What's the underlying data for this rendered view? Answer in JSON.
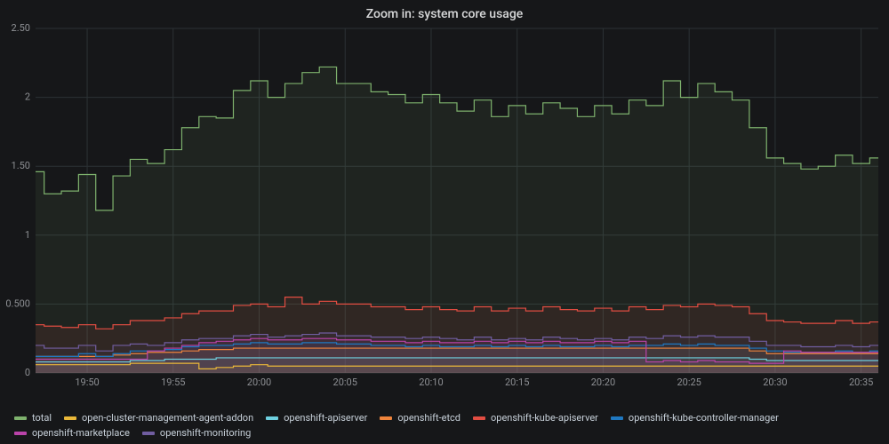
{
  "title": "Zoom in: system core usage",
  "chart_data": {
    "type": "area",
    "xlabel": "",
    "ylabel": "",
    "ylim": [
      0,
      2.5
    ],
    "y_ticks": [
      0,
      0.5,
      1,
      1.5,
      2,
      2.5
    ],
    "y_tick_labels": [
      "0",
      "0.500",
      "1",
      "1.50",
      "2",
      "2.50"
    ],
    "x_tick_labels": [
      "19:50",
      "19:55",
      "20:00",
      "20:05",
      "20:10",
      "20:15",
      "20:20",
      "20:25",
      "20:30",
      "20:35"
    ],
    "x_tick_index": [
      3,
      8,
      13,
      18,
      23,
      28,
      33,
      38,
      43,
      48
    ],
    "x": [
      0,
      1,
      2,
      3,
      4,
      5,
      6,
      7,
      8,
      9,
      10,
      11,
      12,
      13,
      14,
      15,
      16,
      17,
      18,
      19,
      20,
      21,
      22,
      23,
      24,
      25,
      26,
      27,
      28,
      29,
      30,
      31,
      32,
      33,
      34,
      35,
      36,
      37,
      38,
      39,
      40,
      41,
      42,
      43,
      44,
      45,
      46,
      47,
      48,
      49
    ],
    "series": [
      {
        "name": "total",
        "color": "#7eb26d",
        "values": [
          1.46,
          1.3,
          1.32,
          1.44,
          1.18,
          1.43,
          1.55,
          1.52,
          1.62,
          1.78,
          1.86,
          1.85,
          2.05,
          2.12,
          2.0,
          2.1,
          2.18,
          2.22,
          2.1,
          2.1,
          2.04,
          2.02,
          1.96,
          2.02,
          1.96,
          1.9,
          1.98,
          1.86,
          1.94,
          1.88,
          1.96,
          1.92,
          1.86,
          1.94,
          1.88,
          1.98,
          1.94,
          2.12,
          2.0,
          2.1,
          2.04,
          1.98,
          1.78,
          1.56,
          1.52,
          1.48,
          1.5,
          1.58,
          1.52,
          1.56
        ]
      },
      {
        "name": "open-cluster-management-agent-addon",
        "color": "#eab839",
        "values": [
          0.06,
          0.06,
          0.06,
          0.06,
          0.06,
          0.06,
          0.07,
          0.07,
          0.07,
          0.07,
          0.03,
          0.04,
          0.05,
          0.06,
          0.05,
          0.05,
          0.05,
          0.05,
          0.05,
          0.05,
          0.05,
          0.05,
          0.05,
          0.05,
          0.05,
          0.05,
          0.05,
          0.05,
          0.05,
          0.05,
          0.05,
          0.05,
          0.05,
          0.05,
          0.05,
          0.05,
          0.05,
          0.05,
          0.05,
          0.05,
          0.05,
          0.05,
          0.05,
          0.05,
          0.05,
          0.05,
          0.05,
          0.05,
          0.05,
          0.05
        ]
      },
      {
        "name": "openshift-apiserver",
        "color": "#6ed0e0",
        "values": [
          0.08,
          0.08,
          0.08,
          0.08,
          0.08,
          0.08,
          0.09,
          0.09,
          0.1,
          0.1,
          0.1,
          0.11,
          0.11,
          0.11,
          0.11,
          0.11,
          0.11,
          0.11,
          0.11,
          0.11,
          0.11,
          0.11,
          0.11,
          0.11,
          0.11,
          0.11,
          0.11,
          0.11,
          0.11,
          0.11,
          0.11,
          0.11,
          0.11,
          0.11,
          0.11,
          0.11,
          0.11,
          0.11,
          0.11,
          0.11,
          0.11,
          0.11,
          0.1,
          0.09,
          0.09,
          0.09,
          0.09,
          0.09,
          0.09,
          0.09
        ]
      },
      {
        "name": "openshift-etcd",
        "color": "#ef843c",
        "values": [
          0.12,
          0.12,
          0.12,
          0.12,
          0.12,
          0.13,
          0.14,
          0.15,
          0.15,
          0.16,
          0.17,
          0.17,
          0.18,
          0.18,
          0.18,
          0.18,
          0.18,
          0.18,
          0.18,
          0.18,
          0.18,
          0.18,
          0.18,
          0.18,
          0.18,
          0.18,
          0.18,
          0.18,
          0.18,
          0.18,
          0.18,
          0.18,
          0.18,
          0.18,
          0.18,
          0.18,
          0.18,
          0.18,
          0.18,
          0.18,
          0.18,
          0.18,
          0.16,
          0.14,
          0.14,
          0.14,
          0.14,
          0.14,
          0.14,
          0.14
        ]
      },
      {
        "name": "openshift-kube-apiserver",
        "color": "#e24d42",
        "values": [
          0.35,
          0.34,
          0.33,
          0.35,
          0.32,
          0.35,
          0.38,
          0.38,
          0.4,
          0.43,
          0.45,
          0.45,
          0.49,
          0.5,
          0.48,
          0.55,
          0.5,
          0.52,
          0.5,
          0.5,
          0.48,
          0.48,
          0.46,
          0.48,
          0.46,
          0.45,
          0.48,
          0.45,
          0.47,
          0.45,
          0.48,
          0.46,
          0.45,
          0.47,
          0.45,
          0.48,
          0.46,
          0.49,
          0.48,
          0.5,
          0.49,
          0.48,
          0.43,
          0.38,
          0.37,
          0.36,
          0.36,
          0.38,
          0.36,
          0.37
        ]
      },
      {
        "name": "openshift-kube-controller-manager",
        "color": "#1f78c1",
        "values": [
          0.12,
          0.12,
          0.12,
          0.14,
          0.12,
          0.14,
          0.16,
          0.16,
          0.17,
          0.19,
          0.2,
          0.2,
          0.21,
          0.22,
          0.21,
          0.21,
          0.22,
          0.22,
          0.21,
          0.21,
          0.2,
          0.2,
          0.19,
          0.2,
          0.19,
          0.19,
          0.2,
          0.19,
          0.2,
          0.19,
          0.2,
          0.19,
          0.19,
          0.2,
          0.19,
          0.2,
          0.2,
          0.21,
          0.2,
          0.21,
          0.2,
          0.2,
          0.18,
          0.16,
          0.15,
          0.15,
          0.15,
          0.16,
          0.15,
          0.16
        ]
      },
      {
        "name": "openshift-marketplace",
        "color": "#ba43a9",
        "values": [
          0.1,
          0.1,
          0.1,
          0.1,
          0.1,
          0.1,
          0.1,
          0.16,
          0.18,
          0.2,
          0.22,
          0.23,
          0.24,
          0.25,
          0.24,
          0.24,
          0.25,
          0.25,
          0.24,
          0.24,
          0.23,
          0.23,
          0.22,
          0.23,
          0.22,
          0.22,
          0.23,
          0.22,
          0.23,
          0.22,
          0.23,
          0.22,
          0.22,
          0.23,
          0.22,
          0.23,
          0.08,
          0.09,
          0.08,
          0.09,
          0.08,
          0.08,
          0.07,
          0.07,
          0.16,
          0.15,
          0.15,
          0.15,
          0.15,
          0.15
        ]
      },
      {
        "name": "openshift-monitoring",
        "color": "#705da0",
        "values": [
          0.2,
          0.18,
          0.18,
          0.2,
          0.16,
          0.2,
          0.21,
          0.2,
          0.22,
          0.24,
          0.25,
          0.25,
          0.27,
          0.28,
          0.26,
          0.27,
          0.28,
          0.29,
          0.27,
          0.27,
          0.26,
          0.26,
          0.25,
          0.26,
          0.25,
          0.24,
          0.26,
          0.24,
          0.25,
          0.24,
          0.26,
          0.25,
          0.24,
          0.25,
          0.24,
          0.26,
          0.25,
          0.27,
          0.26,
          0.27,
          0.26,
          0.26,
          0.23,
          0.2,
          0.2,
          0.19,
          0.19,
          0.2,
          0.19,
          0.2
        ]
      }
    ]
  },
  "legend": [
    {
      "label": "total",
      "color": "#7eb26d"
    },
    {
      "label": "open-cluster-management-agent-addon",
      "color": "#eab839"
    },
    {
      "label": "openshift-apiserver",
      "color": "#6ed0e0"
    },
    {
      "label": "openshift-etcd",
      "color": "#ef843c"
    },
    {
      "label": "openshift-kube-apiserver",
      "color": "#e24d42"
    },
    {
      "label": "openshift-kube-controller-manager",
      "color": "#1f78c1"
    },
    {
      "label": "openshift-marketplace",
      "color": "#ba43a9"
    },
    {
      "label": "openshift-monitoring",
      "color": "#705da0"
    }
  ]
}
